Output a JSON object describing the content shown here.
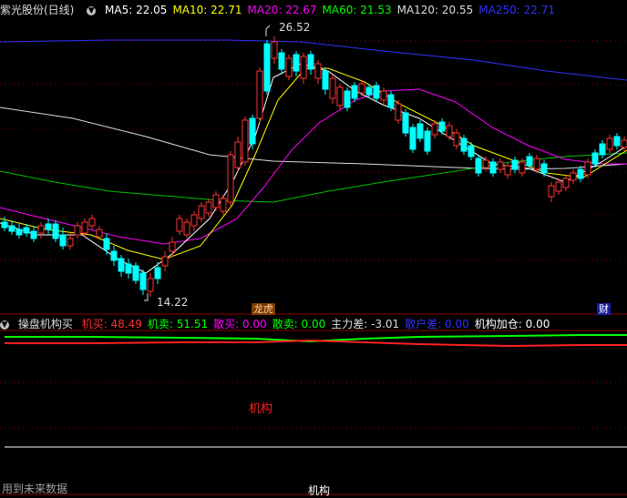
{
  "main_header": {
    "stock_name": "紫光股份(日线)",
    "ma": [
      {
        "label": "MA5: 22.05",
        "color": "#ffffff"
      },
      {
        "label": "MA10: 22.71",
        "color": "#ffff00"
      },
      {
        "label": "MA20: 22.67",
        "color": "#ff00ff"
      },
      {
        "label": "MA60: 21.53",
        "color": "#00ff00"
      },
      {
        "label": "MA120: 20.55",
        "color": "#dcdcdc"
      },
      {
        "label": "MA250: 22.71",
        "color": "#3030ff"
      }
    ]
  },
  "sub_header": {
    "indicator_name": "操盘机构买",
    "fields": [
      {
        "label": "机买: 48.49",
        "color": "#ff3030"
      },
      {
        "label": "机卖: 51.51",
        "color": "#00ff00"
      },
      {
        "label": "散买: 0.00",
        "color": "#ff00ff"
      },
      {
        "label": "散卖: 0.00",
        "color": "#00ff00"
      },
      {
        "label": "主力差: -3.01",
        "color": "#dcdcdc"
      },
      {
        "label": "散户差: 0.00",
        "color": "#3030ff"
      },
      {
        "label": "机构加仓: 0.00",
        "color": "#ffffff"
      }
    ]
  },
  "annotations": {
    "high_price": "26.52",
    "low_price": "14.22",
    "badge_left": "龙虎",
    "badge_right": "财",
    "sub_center_label": "机构",
    "footer_left": "用到未来数据",
    "footer_center": "机构"
  },
  "colors": {
    "up": "#ff3232",
    "down": "#00ffff",
    "grid": "#8b0000",
    "frame": "#8b0000"
  }
}
